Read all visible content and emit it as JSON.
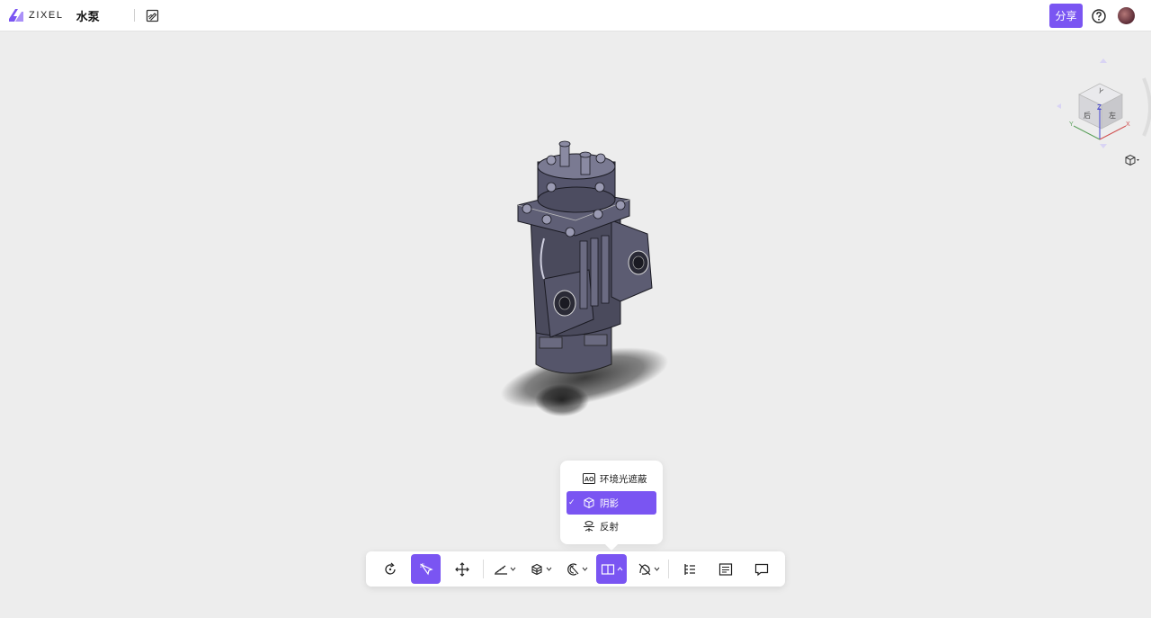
{
  "header": {
    "logo_text": "ZIXEL",
    "doc_title": "水泵",
    "share_label": "分享"
  },
  "navcube": {
    "face_top": "Z",
    "face_left": "后",
    "face_right": "左",
    "face_back": "Y",
    "axis_x": "X",
    "axis_y": "Y"
  },
  "render_menu": {
    "items": [
      {
        "label": "环境光遮蔽",
        "icon": "ao-icon",
        "checked": false
      },
      {
        "label": "阴影",
        "icon": "cube-shadow-icon",
        "checked": true
      },
      {
        "label": "反射",
        "icon": "reflection-icon",
        "checked": false
      }
    ],
    "check_mark": "✓",
    "ao_badge": "AO"
  },
  "toolbar": {
    "buttons": [
      "rotate-icon",
      "select-pointer-icon",
      "pan-move-icon",
      "measure-icon",
      "explode-view-icon",
      "section-icon",
      "render-mode-icon",
      "hide-isolate-icon",
      "model-tree-icon",
      "properties-list-icon",
      "comment-icon"
    ]
  },
  "colors": {
    "accent": "#7a55f2",
    "background": "#ededed",
    "model": "#4a4a5c"
  }
}
